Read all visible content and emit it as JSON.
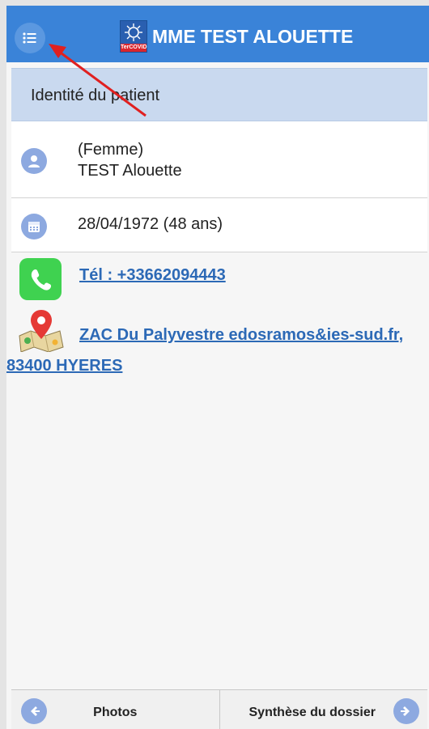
{
  "header": {
    "title": "MME TEST ALOUETTE",
    "logo_text": "TerCOVID",
    "accent": "#3a83d8"
  },
  "section": {
    "title": "Identité du patient"
  },
  "patient": {
    "gender": "(Femme)",
    "name": "TEST Alouette",
    "birth": "28/04/1972 (48 ans)",
    "phone": "Tél : +33662094443",
    "address": "ZAC Du Palyvestre edosramos&ies-sud.fr, 83400 HYERES"
  },
  "icons": {
    "menu": "list-icon",
    "person": "person-icon",
    "calendar": "calendar-icon",
    "phone": "phone-icon",
    "map": "map-pin-icon",
    "prev": "arrow-left-icon",
    "next": "arrow-right-icon"
  },
  "footer": {
    "left_label": "Photos",
    "right_label": "Synthèse du dossier"
  }
}
